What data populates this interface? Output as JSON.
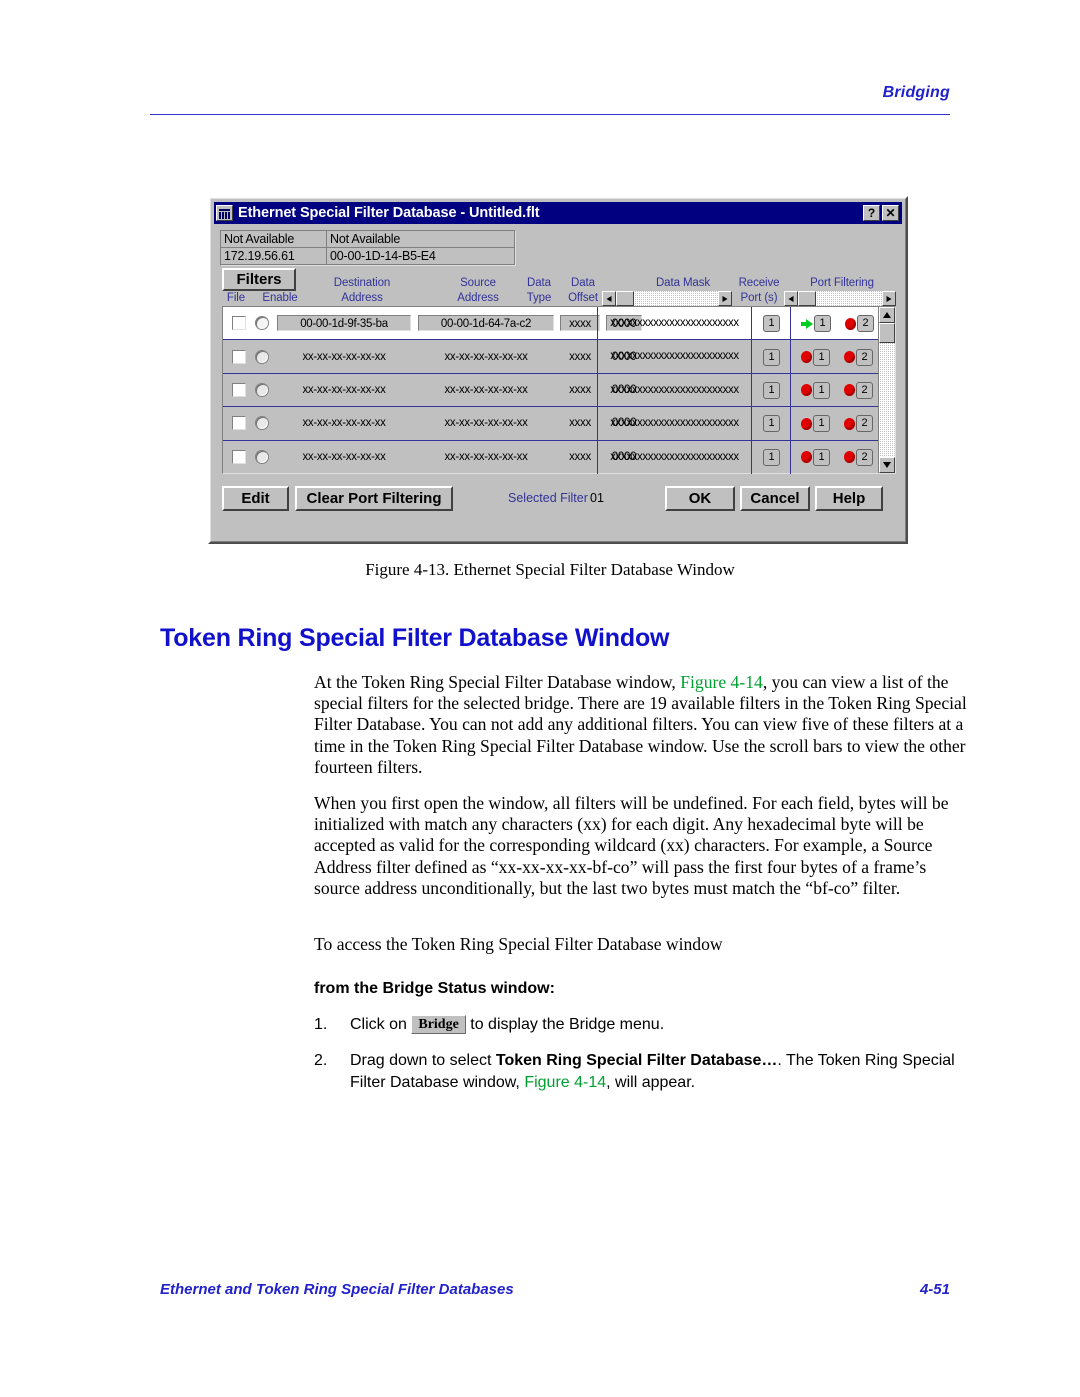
{
  "page": {
    "header_text": "Bridging",
    "footer_left": "Ethernet and Token Ring Special Filter Databases",
    "footer_right": "4-51",
    "figure_caption": "Figure 4-13.  Ethernet Special Filter Database Window",
    "section_heading": "Token Ring Special Filter Database Window"
  },
  "dialog": {
    "title": "Ethernet Special Filter Database - Untitled.flt",
    "icon": "window-columns-icon",
    "titlebar_buttons": [
      {
        "name": "help-button",
        "label": "?"
      },
      {
        "name": "close-button",
        "label": "✕"
      }
    ],
    "info": {
      "row1": [
        "Not Available",
        "Not Available"
      ],
      "row2": [
        "172.19.56.61",
        "00-00-1D-14-B5-E4"
      ]
    },
    "filters_button": "Filters",
    "column_headers": {
      "file": "File",
      "enable": "Enable",
      "destination_line1": "Destination",
      "destination_line2": "Address",
      "source_line1": "Source",
      "source_line2": "Address",
      "data_type_line1": "Data",
      "data_type_line2": "Type",
      "data_offset_line1": "Data",
      "data_offset_line2": "Offset",
      "data_mask": "Data Mask",
      "receive_port_line1": "Receive",
      "receive_port_line2": "Port (s)",
      "port_filtering": "Port Filtering"
    },
    "rows": [
      {
        "selected": true,
        "destination": "00-00-1d-9f-35-ba",
        "source": "00-00-1d-64-7a-c2",
        "data_type": "xxxx",
        "data_offset": "0000",
        "data_mask": "xxxxxxxxxxxxxxxxxxxxxxxx",
        "receive_port": "1",
        "port_filtering": [
          {
            "icon": "green-arrow-icon",
            "port": "1"
          },
          {
            "icon": "red-dot-icon",
            "port": "2"
          }
        ]
      },
      {
        "selected": false,
        "destination": "xx-xx-xx-xx-xx-xx",
        "source": "xx-xx-xx-xx-xx-xx",
        "data_type": "xxxx",
        "data_offset": "0000",
        "data_mask": "xxxxxxxxxxxxxxxxxxxxxxxx",
        "receive_port": "1",
        "port_filtering": [
          {
            "icon": "red-dot-icon",
            "port": "1"
          },
          {
            "icon": "red-dot-icon",
            "port": "2"
          }
        ]
      },
      {
        "selected": false,
        "destination": "xx-xx-xx-xx-xx-xx",
        "source": "xx-xx-xx-xx-xx-xx",
        "data_type": "xxxx",
        "data_offset": "0000",
        "data_mask": "xxxxxxxxxxxxxxxxxxxxxxxx",
        "receive_port": "1",
        "port_filtering": [
          {
            "icon": "red-dot-icon",
            "port": "1"
          },
          {
            "icon": "red-dot-icon",
            "port": "2"
          }
        ]
      },
      {
        "selected": false,
        "destination": "xx-xx-xx-xx-xx-xx",
        "source": "xx-xx-xx-xx-xx-xx",
        "data_type": "xxxx",
        "data_offset": "0000",
        "data_mask": "xxxxxxxxxxxxxxxxxxxxxxxx",
        "receive_port": "1",
        "port_filtering": [
          {
            "icon": "red-dot-icon",
            "port": "1"
          },
          {
            "icon": "red-dot-icon",
            "port": "2"
          }
        ]
      },
      {
        "selected": false,
        "destination": "xx-xx-xx-xx-xx-xx",
        "source": "xx-xx-xx-xx-xx-xx",
        "data_type": "xxxx",
        "data_offset": "0000",
        "data_mask": "xxxxxxxxxxxxxxxxxxxxxxxx",
        "receive_port": "1",
        "port_filtering": [
          {
            "icon": "red-dot-icon",
            "port": "1"
          },
          {
            "icon": "red-dot-icon",
            "port": "2"
          }
        ]
      }
    ],
    "footer_buttons": {
      "edit": "Edit",
      "clear_port_filtering": "Clear Port Filtering",
      "ok": "OK",
      "cancel": "Cancel",
      "help": "Help"
    },
    "selected_filter_label": "Selected Filter",
    "selected_filter_value": "01",
    "colors": {
      "titlebar": "#000080",
      "face": "#c0c0c0",
      "header_label": "#333399",
      "grid_line": "#333399",
      "status_red": "#e00000",
      "status_green": "#00cc22"
    }
  },
  "body": {
    "para1_a": "At the Token Ring Special Filter Database window, ",
    "para1_ref": "Figure 4-14",
    "para1_b": ", you can view a list of the special filters for the selected bridge. There are 19 available filters in the Token Ring Special Filter Database. You can not add any additional filters. You can view five of these filters at a time in the Token Ring Special Filter Database window. Use the scroll bars to view the other fourteen filters.",
    "para2": "When you first open the window, all filters will be undefined. For each field, bytes will be initialized with match any characters (xx) for each digit. Any hexadecimal byte will be accepted as valid for the corresponding wildcard (xx) characters. For example, a Source Address filter defined as “xx-xx-xx-xx-bf-co” will pass the first four bytes of a frame’s source address unconditionally, but the last two bytes must match the “bf-co” filter.",
    "para3": "To access the Token Ring Special Filter Database window",
    "substep_heading": "from the Bridge Status window:",
    "step1": {
      "num": "1.",
      "a": "Click on ",
      "button": "Bridge",
      "b": " to display the Bridge menu."
    },
    "step2": {
      "num": "2.",
      "a": "Drag down to select ",
      "bold": "Token Ring Special Filter Database…",
      "b": ". The Token Ring Special Filter Database window, ",
      "ref": "Figure 4-14",
      "c": ", will appear."
    }
  }
}
